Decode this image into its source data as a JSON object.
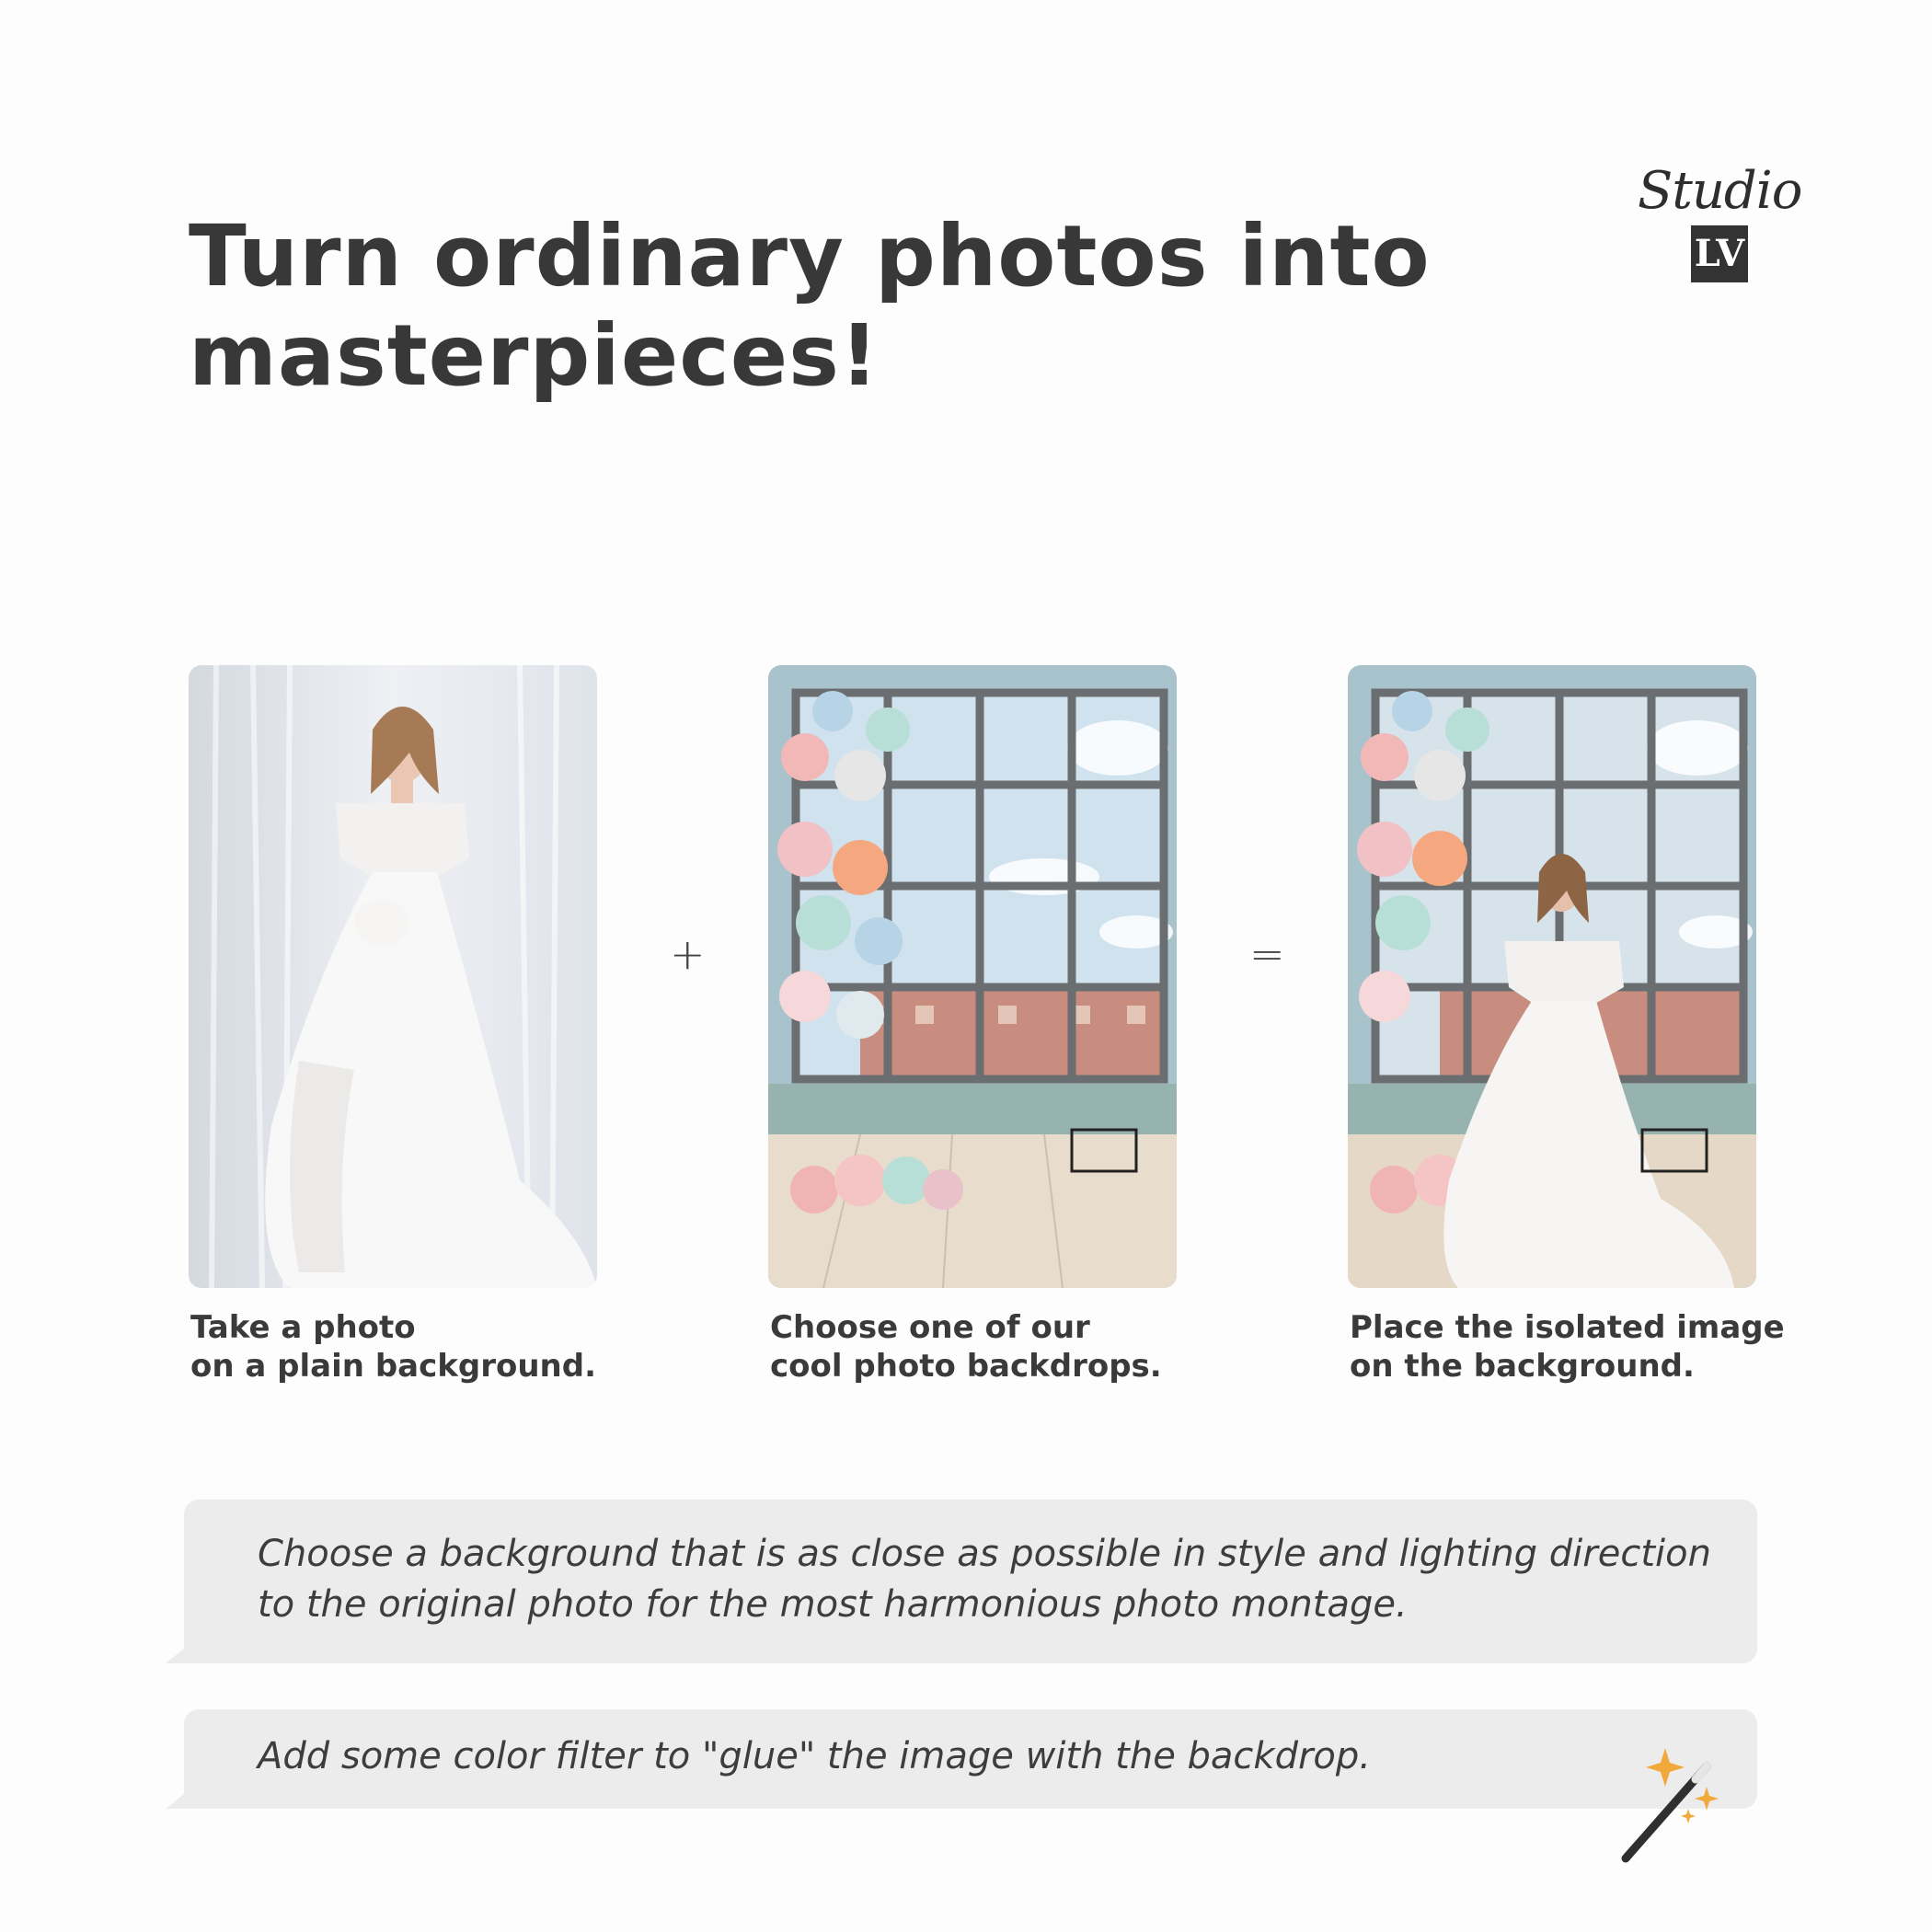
{
  "header": {
    "title_line1": "Turn ordinary photos into",
    "title_line2": "masterpieces!"
  },
  "logo": {
    "script_text": "Studio",
    "mark_text": "LV"
  },
  "steps": [
    {
      "caption_line1": "Take a photo",
      "caption_line2": "on a plain background."
    },
    {
      "caption_line1": "Choose one of our",
      "caption_line2": "cool photo backdrops."
    },
    {
      "caption_line1": "Place the isolated image",
      "caption_line2": "on the background."
    }
  ],
  "operators": {
    "plus": "+",
    "equals": "="
  },
  "tips": [
    {
      "line1": "Choose a background that is as close as possible in style and lighting direction",
      "line2": "to the original photo for the most harmonious photo montage."
    },
    {
      "line1": "Add some color filter to \"glue\" the image with the backdrop."
    }
  ],
  "icons": {
    "decor": "magic-wand-icon"
  },
  "colors": {
    "text": "#383838",
    "tip_bg": "#ececec",
    "accent": "#f2a93b"
  }
}
